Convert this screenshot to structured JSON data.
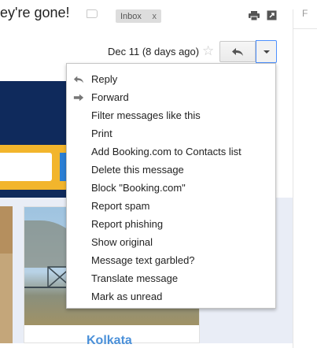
{
  "header": {
    "subject": "ey're gone!",
    "label_chip": "Inbox",
    "label_chip_remove": "x",
    "right_column_text": "F"
  },
  "message": {
    "date": "Dec 11 (8 days ago)",
    "city_title": "Kolkata"
  },
  "icons": {
    "label": "label-tag-icon",
    "print": "print-icon",
    "new_window": "new-window-icon",
    "star": "star-icon",
    "reply": "reply-icon",
    "more": "caret-down-icon"
  },
  "menu": {
    "items": [
      {
        "label": "Reply",
        "icon": "reply-icon"
      },
      {
        "label": "Forward",
        "icon": "forward-icon"
      },
      {
        "label": "Filter messages like this"
      },
      {
        "label": "Print"
      },
      {
        "label": "Add Booking.com to Contacts list"
      },
      {
        "label": "Delete this message"
      },
      {
        "label": "Block \"Booking.com\""
      },
      {
        "label": "Report spam"
      },
      {
        "label": "Report phishing"
      },
      {
        "label": "Show original"
      },
      {
        "label": "Message text garbled?"
      },
      {
        "label": "Translate message"
      },
      {
        "label": "Mark as unread"
      }
    ]
  },
  "colors": {
    "accent_blue": "#4d90fe",
    "banner_navy": "#0f2a5c",
    "banner_yellow": "#f2b52c",
    "link_blue": "#4a90d9"
  }
}
